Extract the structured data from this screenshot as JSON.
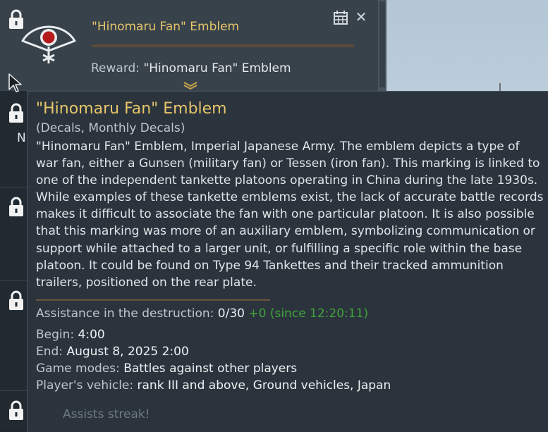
{
  "task": {
    "title": "\"Hinomaru Fan\" Emblem",
    "reward_label": "Reward:",
    "reward_value": "\"Hinomaru Fan\" Emblem",
    "progress": 0
  },
  "tooltip": {
    "title": "\"Hinomaru Fan\" Emblem",
    "category": "(Decals, Monthly Decals)",
    "description": "\"Hinomaru Fan\" Emblem, Imperial Japanese Army. The emblem depicts a type of war fan, either a Gunsen (military fan) or Tessen (iron fan). This marking is linked to one of the independent tankette platoons operating in China during the late 1930s. While examples of these tankette emblems exist, the lack of accurate battle records makes it difficult to associate the fan with one particular platoon. It is also possible that this marking was more of an auxiliary emblem, symbolizing communication or support while attached to a larger unit, or fulfilling a specific role within the base platoon. It could be found on Type 94 Tankettes and their tracked ammunition trailers, positioned on the rear plate.",
    "assistance_label": "Assistance in the destruction:",
    "assistance_value": "0/30",
    "assistance_delta": "+0 (since 12:20:11)",
    "begin_label": "Begin:",
    "begin_value": "4:00",
    "end_label": "End:",
    "end_value": "August 8, 2025 2:00",
    "modes_label": "Game modes:",
    "modes_value": "Battles against other players",
    "vehicle_label": "Player's vehicle:",
    "vehicle_value": "rank III and above, Ground vehicles, Japan"
  },
  "next_task_title": "Assists streak!",
  "partial_letter": "N",
  "icons": {
    "lock": "lock-icon",
    "calendar": "calendar-icon",
    "close": "close-icon",
    "expand": "chevron-down-icon",
    "emblem": "fan-emblem-icon",
    "cursor": "mouse-pointer-icon"
  },
  "colors": {
    "accent_gold": "#e8c56a",
    "assist_green": "#3fa33a",
    "panel_bg": "#2b343d"
  }
}
